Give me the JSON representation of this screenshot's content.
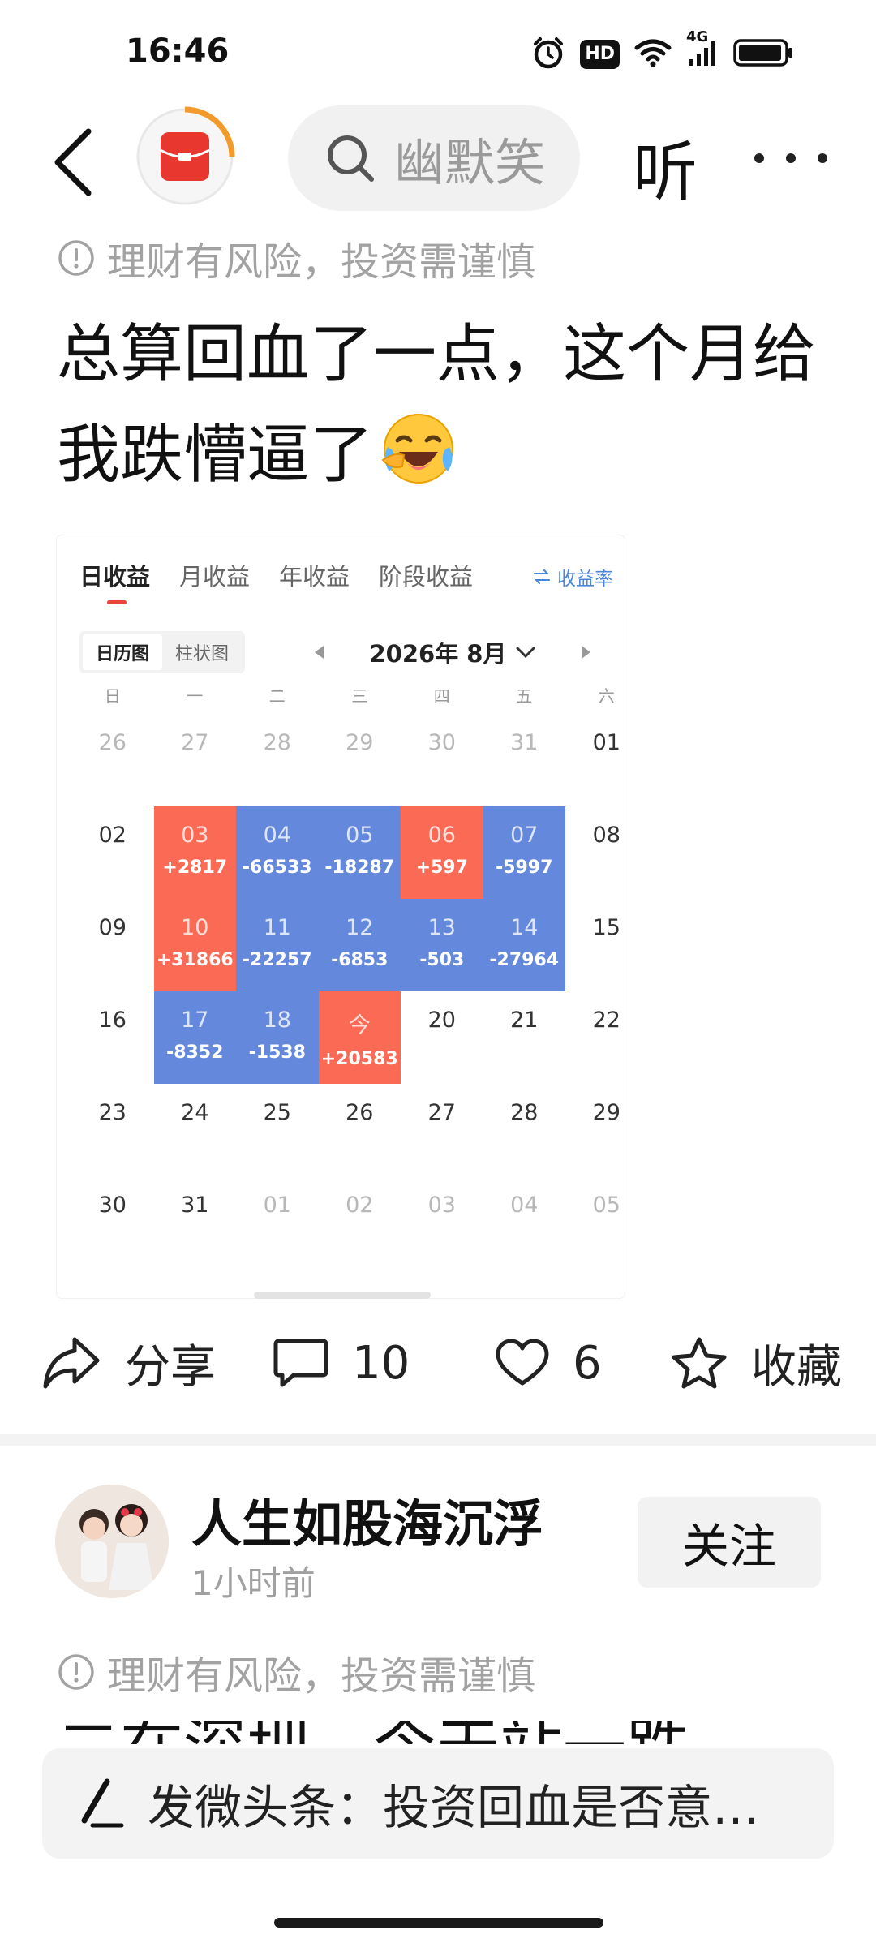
{
  "status_bar": {
    "time": "16:46",
    "hd_label": "HD",
    "network_label": "4G"
  },
  "nav": {
    "search_placeholder": "幽默笑",
    "listen_label": "听"
  },
  "post": {
    "disclaimer": "理财有风险，投资需谨慎",
    "title": "总算回血了一点，这个月给我跌懵逼了",
    "emoji": "face-with-tears-of-joy"
  },
  "calendar_card": {
    "tabs": [
      "日收益",
      "月收益",
      "年收益",
      "阶段收益"
    ],
    "active_tab": "日收益",
    "yield_link": "收益率",
    "view_options": [
      "日历图",
      "柱状图"
    ],
    "active_view": "日历图",
    "month": "2026年 8月",
    "weekdays": [
      "日",
      "一",
      "二",
      "三",
      "四",
      "五",
      "六"
    ],
    "weeks": [
      [
        {
          "day": "26",
          "value": "",
          "type": "muted"
        },
        {
          "day": "27",
          "value": "",
          "type": "muted"
        },
        {
          "day": "28",
          "value": "",
          "type": "muted"
        },
        {
          "day": "29",
          "value": "",
          "type": "muted"
        },
        {
          "day": "30",
          "value": "",
          "type": "muted"
        },
        {
          "day": "31",
          "value": "",
          "type": "muted"
        },
        {
          "day": "01",
          "value": "",
          "type": "normal"
        }
      ],
      [
        {
          "day": "02",
          "value": "",
          "type": "normal"
        },
        {
          "day": "03",
          "value": "+2817",
          "type": "gain"
        },
        {
          "day": "04",
          "value": "-66533",
          "type": "loss"
        },
        {
          "day": "05",
          "value": "-18287",
          "type": "loss"
        },
        {
          "day": "06",
          "value": "+597",
          "type": "gain"
        },
        {
          "day": "07",
          "value": "-5997",
          "type": "loss"
        },
        {
          "day": "08",
          "value": "",
          "type": "normal"
        }
      ],
      [
        {
          "day": "09",
          "value": "",
          "type": "normal"
        },
        {
          "day": "10",
          "value": "+31866",
          "type": "gain"
        },
        {
          "day": "11",
          "value": "-22257",
          "type": "loss"
        },
        {
          "day": "12",
          "value": "-6853",
          "type": "loss"
        },
        {
          "day": "13",
          "value": "-503",
          "type": "loss"
        },
        {
          "day": "14",
          "value": "-27964",
          "type": "loss"
        },
        {
          "day": "15",
          "value": "",
          "type": "normal"
        }
      ],
      [
        {
          "day": "16",
          "value": "",
          "type": "normal"
        },
        {
          "day": "17",
          "value": "-8352",
          "type": "loss"
        },
        {
          "day": "18",
          "value": "-1538",
          "type": "loss"
        },
        {
          "day": "今",
          "value": "+20583",
          "type": "gain"
        },
        {
          "day": "20",
          "value": "",
          "type": "normal"
        },
        {
          "day": "21",
          "value": "",
          "type": "normal"
        },
        {
          "day": "22",
          "value": "",
          "type": "normal"
        }
      ],
      [
        {
          "day": "23",
          "value": "",
          "type": "normal"
        },
        {
          "day": "24",
          "value": "",
          "type": "normal"
        },
        {
          "day": "25",
          "value": "",
          "type": "normal"
        },
        {
          "day": "26",
          "value": "",
          "type": "normal"
        },
        {
          "day": "27",
          "value": "",
          "type": "normal"
        },
        {
          "day": "28",
          "value": "",
          "type": "normal"
        },
        {
          "day": "29",
          "value": "",
          "type": "normal"
        }
      ],
      [
        {
          "day": "30",
          "value": "",
          "type": "normal"
        },
        {
          "day": "31",
          "value": "",
          "type": "normal"
        },
        {
          "day": "01",
          "value": "",
          "type": "muted"
        },
        {
          "day": "02",
          "value": "",
          "type": "muted"
        },
        {
          "day": "03",
          "value": "",
          "type": "muted"
        },
        {
          "day": "04",
          "value": "",
          "type": "muted"
        },
        {
          "day": "05",
          "value": "",
          "type": "muted"
        }
      ]
    ],
    "colors": {
      "gain": "#fa6a55",
      "loss": "#6489dc"
    }
  },
  "actions": {
    "share_label": "分享",
    "comment_count": "10",
    "like_count": "6",
    "favorite_label": "收藏"
  },
  "next_post": {
    "author": "人生如股海沉浮",
    "time": "1小时前",
    "follow_label": "关注",
    "disclaimer": "理财有风险，投资需谨慎",
    "partial_text": "二在深圳，今天站一跌"
  },
  "compose": {
    "text": "发微头条：投资回血是否意…"
  }
}
